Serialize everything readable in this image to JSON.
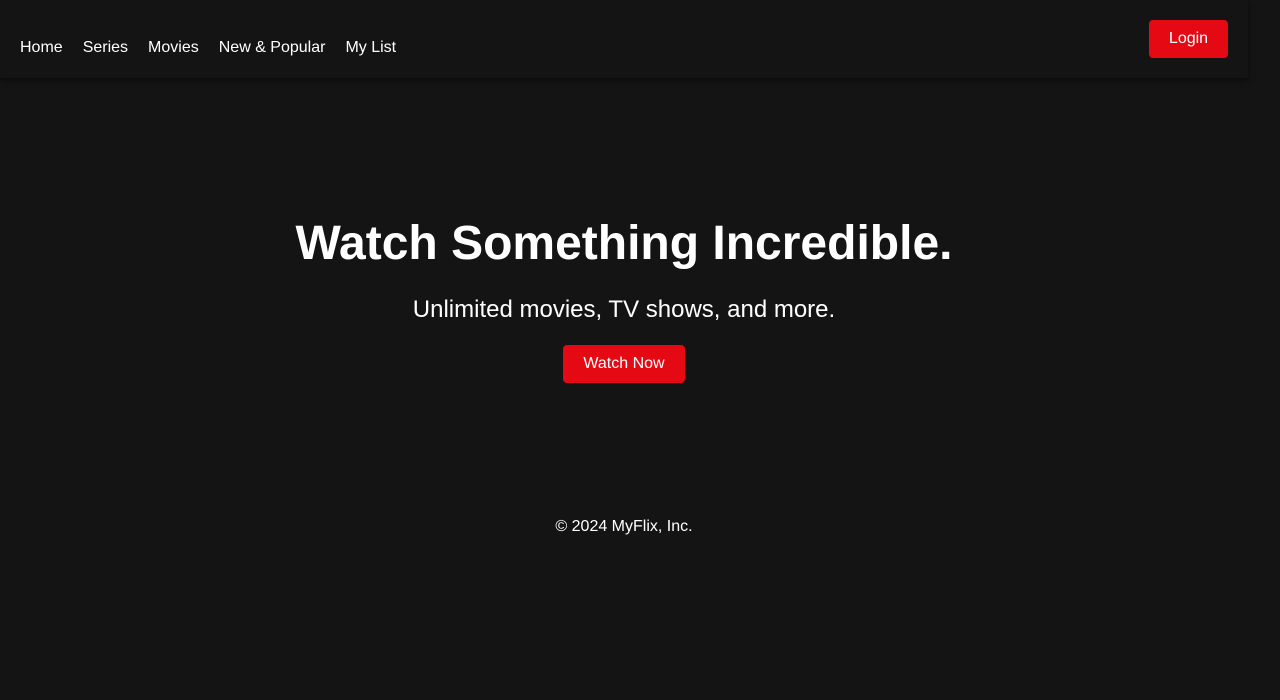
{
  "nav": {
    "items": [
      {
        "label": "Home"
      },
      {
        "label": "Series"
      },
      {
        "label": "Movies"
      },
      {
        "label": "New & Popular"
      },
      {
        "label": "My List"
      }
    ],
    "login_label": "Login"
  },
  "hero": {
    "title": "Watch Something Incredible.",
    "subtitle": "Unlimited movies, TV shows, and more.",
    "cta_label": "Watch Now"
  },
  "footer": {
    "copyright": "© 2024 MyFlix, Inc."
  },
  "colors": {
    "background": "#141414",
    "accent": "#e50914",
    "text": "#ffffff"
  }
}
